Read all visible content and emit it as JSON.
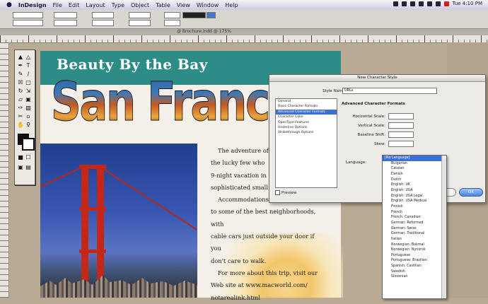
{
  "menubar": {
    "apple": " ",
    "items": [
      "InDesign",
      "File",
      "Edit",
      "Layout",
      "Type",
      "Object",
      "Table",
      "View",
      "Window",
      "Help"
    ],
    "clock": "Tue 4:10 PM"
  },
  "document": {
    "title": "@ Brochure.indd @ 175%",
    "headline": "Beauty By the Bay",
    "big_title": "San Francisco",
    "body_paragraphs": [
      "The adventure of a",
      "the lucky few who",
      "9-night vacation in",
      "sophisticated small ci",
      "Accommodations are l",
      "to some of the best neighborhoods, with",
      "cable cars just outside your door if you",
      "don't care to walk.",
      "For more about this trip, visit our",
      "Web site at www.macworld.com/",
      "notarealink.html"
    ]
  },
  "dialog": {
    "title": "New Character Style",
    "style_name_label": "Style Name:",
    "style_name_value": "URLs",
    "categories": [
      "General",
      "Basic Character Formats",
      "Advanced Character Formats",
      "Character Color",
      "OpenType Features",
      "Underline Options",
      "Strikethrough Options"
    ],
    "selected_category_index": 2,
    "section_title": "Advanced Character Formats",
    "fields": [
      "Horizontal Scale:",
      "Vertical Scale:",
      "Baseline Shift:",
      "Skew:"
    ],
    "language_label": "Language:",
    "preview_label": "Preview",
    "ok_label": "OK"
  },
  "language_menu": {
    "options": [
      "[No Language]",
      "Bulgarian",
      "Catalan",
      "Danish",
      "Dutch",
      "English: UK",
      "English: USA",
      "English: USA Legal",
      "English: USA Medical",
      "Finnish",
      "French",
      "French: Canadian",
      "German: Reformed",
      "German: Swiss",
      "German: Traditional",
      "Italian",
      "Norwegian: Bokmal",
      "Norwegian: Nynorsk",
      "Portuguese",
      "Portuguese: Brazilian",
      "Spanish: Castilian",
      "Swedish",
      "Slovenian"
    ],
    "selected_index": 0
  },
  "colors": {
    "banner": "#2e8c86",
    "highlight": "#3d6fd8",
    "tower": "#c42618"
  }
}
